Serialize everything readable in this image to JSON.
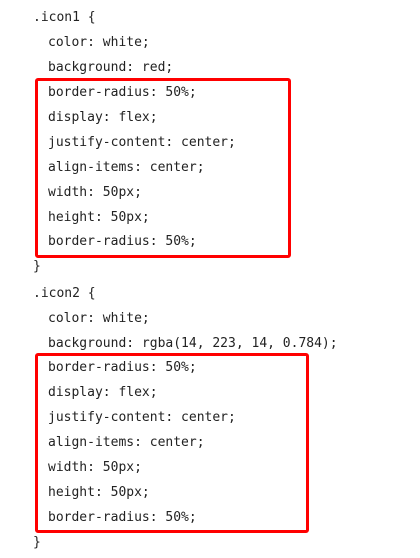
{
  "code": {
    "block1": {
      "selector_line": ".icon1 {",
      "lines": [
        "color: white;",
        "background: red;"
      ],
      "highlighted_lines": [
        "border-radius: 50%;",
        "display: flex;",
        "justify-content: center;",
        "align-items: center;",
        "width: 50px;",
        "height: 50px;",
        "border-radius: 50%;"
      ],
      "closing": "}"
    },
    "block2": {
      "selector_line": ".icon2 {",
      "lines": [
        "color: white;",
        "background: rgba(14, 223, 14, 0.784);"
      ],
      "highlighted_lines": [
        "border-radius: 50%;",
        "display: flex;",
        "justify-content: center;",
        "align-items: center;",
        "width: 50px;",
        "height: 50px;",
        "border-radius: 50%;"
      ],
      "closing": "}"
    }
  },
  "colors": {
    "text": "#222222",
    "highlight_border": "#ff0000",
    "background": "#ffffff"
  }
}
